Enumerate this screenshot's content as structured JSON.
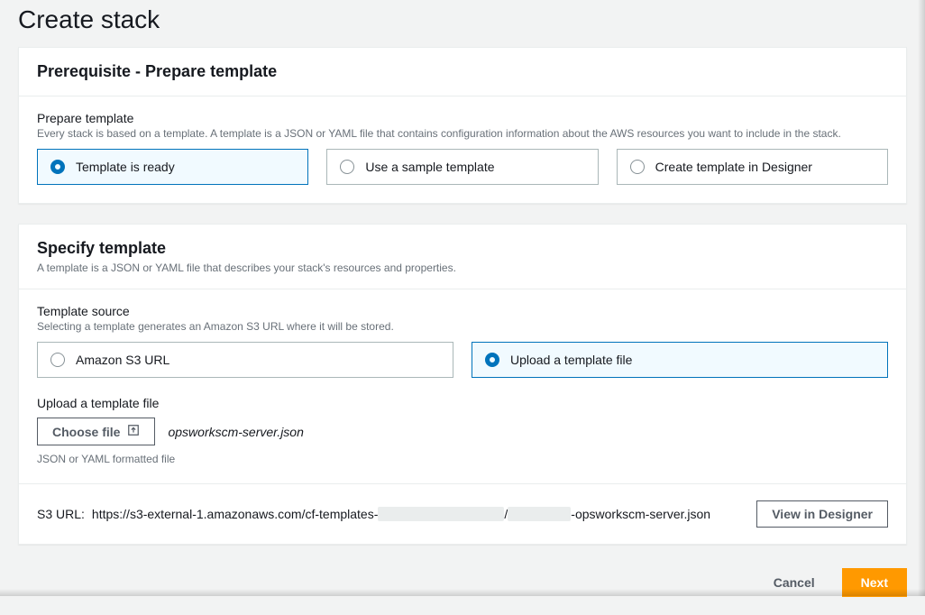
{
  "pageTitle": "Create stack",
  "prereq": {
    "title": "Prerequisite - Prepare template",
    "group": {
      "label": "Prepare template",
      "desc": "Every stack is based on a template. A template is a JSON or YAML file that contains configuration information about the AWS resources you want to include in the stack."
    },
    "options": {
      "ready": "Template is ready",
      "sample": "Use a sample template",
      "designer": "Create template in Designer"
    }
  },
  "specify": {
    "title": "Specify template",
    "subtitle": "A template is a JSON or YAML file that describes your stack's resources and properties.",
    "sourceGroup": {
      "label": "Template source",
      "desc": "Selecting a template generates an Amazon S3 URL where it will be stored."
    },
    "sourceOptions": {
      "s3": "Amazon S3 URL",
      "upload": "Upload a template file"
    },
    "upload": {
      "label": "Upload a template file",
      "chooseBtn": "Choose file",
      "filename": "opsworkscm-server.json",
      "hint": "JSON or YAML formatted file"
    },
    "s3url": {
      "label": "S3 URL:",
      "part1": "https://s3-external-1.amazonaws.com/cf-templates-",
      "sep": "/",
      "part2": "-opsworkscm-server.json",
      "viewBtn": "View in Designer"
    }
  },
  "footer": {
    "cancel": "Cancel",
    "next": "Next"
  }
}
